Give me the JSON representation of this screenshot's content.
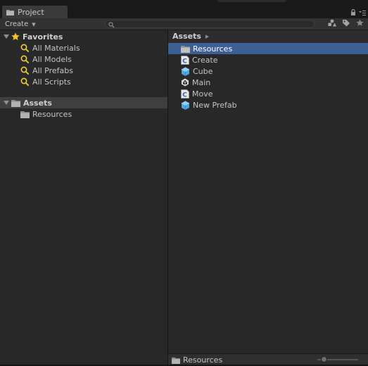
{
  "window": {
    "tab_label": "Project"
  },
  "toolbar": {
    "create_label": "Create",
    "search_placeholder": ""
  },
  "left_pane": {
    "favorites": {
      "title": "Favorites",
      "items": [
        {
          "label": "All Materials"
        },
        {
          "label": "All Models"
        },
        {
          "label": "All Prefabs"
        },
        {
          "label": "All Scripts"
        }
      ]
    },
    "assets": {
      "title": "Assets",
      "children": [
        {
          "label": "Resources"
        }
      ]
    }
  },
  "right_pane": {
    "breadcrumb": "Assets",
    "items": [
      {
        "label": "Resources",
        "icon": "folder-icon",
        "selected": true
      },
      {
        "label": "Create",
        "icon": "csharp-script-icon",
        "selected": false
      },
      {
        "label": "Cube",
        "icon": "prefab-cube-icon",
        "selected": false
      },
      {
        "label": "Main",
        "icon": "unity-scene-icon",
        "selected": false
      },
      {
        "label": "Move",
        "icon": "csharp-script-icon",
        "selected": false
      },
      {
        "label": "New Prefab",
        "icon": "prefab-cube-icon",
        "selected": false
      }
    ],
    "status_path": "Resources",
    "zoom_level": 0.1
  },
  "colors": {
    "selection": "#3e5f96",
    "favorites_star": "#f2c32c",
    "search_icon": "#e8c53a",
    "prefab": "#5fb6ea"
  }
}
